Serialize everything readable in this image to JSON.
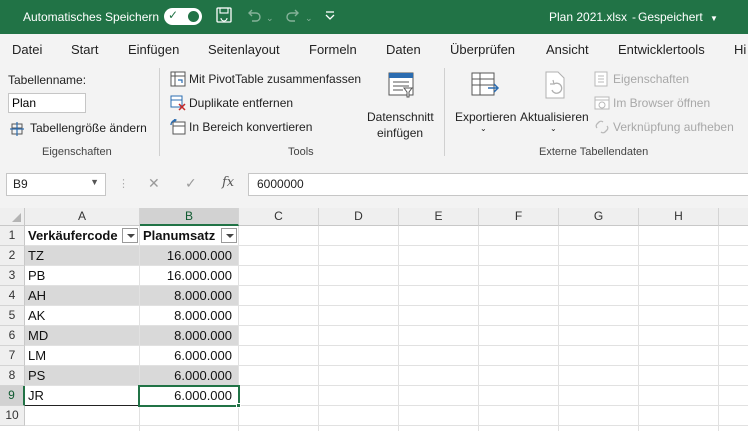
{
  "titlebar": {
    "autosave_label": "Automatisches Speichern",
    "document_name": "Plan 2021.xlsx",
    "separator": "-",
    "save_status": "Gespeichert"
  },
  "tabs": [
    "Datei",
    "Start",
    "Einfügen",
    "Seitenlayout",
    "Formeln",
    "Daten",
    "Überprüfen",
    "Ansicht",
    "Entwicklertools",
    "Hi"
  ],
  "ribbon": {
    "eigenschaften": {
      "table_name_label": "Tabellenname:",
      "table_name_value": "Plan",
      "resize_label": "Tabellengröße ändern",
      "group_title": "Eigenschaften"
    },
    "tools": {
      "pivot_label": "Mit PivotTable zusammenfassen",
      "duplicates_label": "Duplikate entfernen",
      "convert_label": "In Bereich konvertieren",
      "slicer_label_1": "Datenschnitt",
      "slicer_label_2": "einfügen",
      "group_title": "Tools"
    },
    "external": {
      "export_label": "Exportieren",
      "refresh_label": "Aktualisieren",
      "properties_label": "Eigenschaften",
      "browser_label": "Im Browser öffnen",
      "unlink_label": "Verknüpfung aufheben",
      "group_title": "Externe Tabellendaten"
    }
  },
  "formula_bar": {
    "name_box": "B9",
    "fx_label": "fx",
    "formula": "6000000"
  },
  "grid": {
    "columns": [
      "A",
      "B",
      "C",
      "D",
      "E",
      "F",
      "G",
      "H"
    ],
    "rows": [
      "1",
      "2",
      "3",
      "4",
      "5",
      "6",
      "7",
      "8",
      "9",
      "10"
    ],
    "table": {
      "headers": [
        "Verkäufercode",
        "Planumsatz"
      ],
      "rows": [
        [
          "TZ",
          "16.000.000"
        ],
        [
          "PB",
          "16.000.000"
        ],
        [
          "AH",
          "8.000.000"
        ],
        [
          "AK",
          "8.000.000"
        ],
        [
          "MD",
          "8.000.000"
        ],
        [
          "LM",
          "6.000.000"
        ],
        [
          "PS",
          "6.000.000"
        ],
        [
          "JR",
          "6.000.000"
        ]
      ]
    },
    "selected_cell": "B9"
  },
  "colors": {
    "accent": "#217346",
    "band": "#d9d9d9"
  },
  "icons": {
    "save": "save-icon",
    "undo": "undo-icon",
    "redo": "redo-icon",
    "customize": "customize-quick-access-icon",
    "pivot": "pivot-table-icon",
    "duplicates": "remove-duplicates-icon",
    "convert": "convert-to-range-icon",
    "resize": "resize-table-icon",
    "slicer": "slicer-icon",
    "export": "export-icon",
    "refresh": "refresh-icon",
    "properties": "properties-icon",
    "browser": "open-in-browser-icon",
    "unlink": "unlink-icon"
  }
}
